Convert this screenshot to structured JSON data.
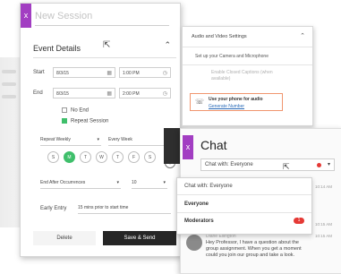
{
  "session": {
    "close_icon": "x",
    "title_placeholder": "New Session",
    "section_title": "Event Details",
    "start_label": "Start",
    "start_date": "8/3/15",
    "start_time": "1:00 PM",
    "end_label": "End",
    "end_date": "8/3/15",
    "end_time": "2:00 PM",
    "no_end_label": "No End",
    "repeat_label": "Repeat Session",
    "repeat_freq": "Repeat Weekly",
    "repeat_every": "Every Week",
    "days": [
      "S",
      "M",
      "T",
      "W",
      "T",
      "F",
      "S"
    ],
    "selected_day_index": 1,
    "end_after": "End After Occurrences",
    "occurrences": "10",
    "early_entry_label": "Early Entry",
    "early_entry_value": "15 mins prior to start time",
    "delete_label": "Delete",
    "save_label": "Save & Send",
    "colors": {
      "accent": "#a23ec2",
      "green": "#3fbf6b",
      "dark": "#262626"
    }
  },
  "audio_video": {
    "title": "Audio and Video Settings",
    "camera_mic": "Set up your Camera and Microphone",
    "captions": "Enable Closed Captions (when available)",
    "phone_title": "Use your phone for audio",
    "phone_link": "Generate Number",
    "accent_border": "#f0956e"
  },
  "chat": {
    "close_icon": "x",
    "title": "Chat",
    "selected": "Chat with: Everyone",
    "dropdown": {
      "header": "Chat with: Everyone",
      "everyone": "Everyone",
      "moderators": "Moderators",
      "moderators_badge": "1"
    },
    "time1": "10:14 AM",
    "time2": "10:15 AM",
    "time3": "10:15 AM",
    "msg_name": "Diane Ellington",
    "msg_text": "Hey Professor, I have a question about the group assignment. When you get a moment could you join our group and take a look."
  }
}
